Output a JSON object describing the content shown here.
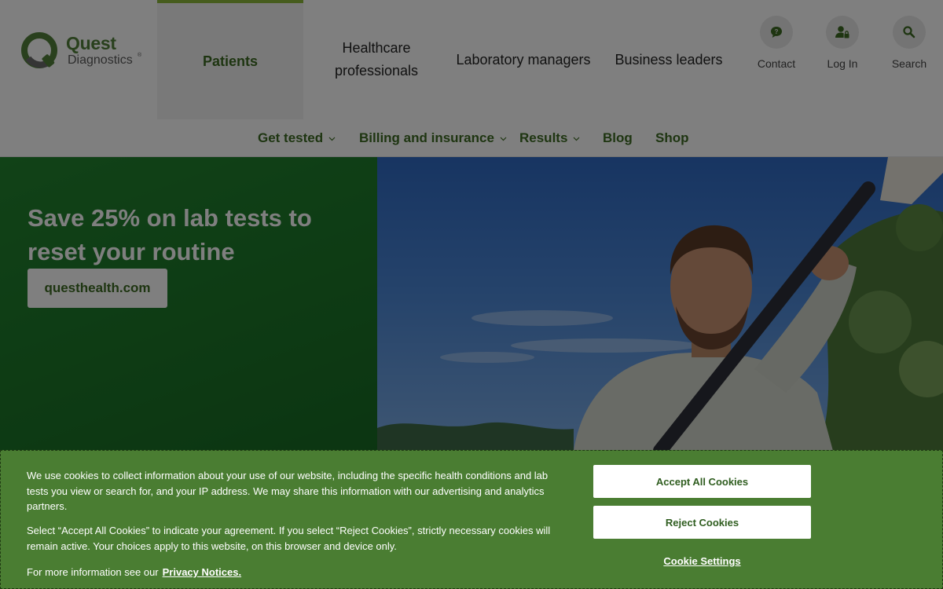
{
  "brand": {
    "name_line1": "Quest",
    "name_line2": "Diagnostics",
    "reg_mark": "®",
    "primary_color": "#52803a",
    "accent_color": "#8cb83a"
  },
  "audience_tabs": [
    {
      "label": "Patients",
      "active": true
    },
    {
      "label": "Healthcare professionals",
      "active": false
    },
    {
      "label": "Laboratory managers",
      "active": false
    },
    {
      "label": "Business leaders",
      "active": false
    }
  ],
  "utility_nav": [
    {
      "label": "Contact",
      "icon": "chat-bubble-icon"
    },
    {
      "label": "Log In",
      "icon": "user-lock-icon"
    },
    {
      "label": "Search",
      "icon": "search-icon"
    }
  ],
  "sub_nav": [
    {
      "label": "Get tested",
      "has_dropdown": true
    },
    {
      "label": "Billing and insurance",
      "has_dropdown": true
    },
    {
      "label": "Results",
      "has_dropdown": true
    },
    {
      "label": "Blog",
      "has_dropdown": false
    },
    {
      "label": "Shop",
      "has_dropdown": false
    }
  ],
  "hero": {
    "title": "Save 25% on lab tests to reset your routine",
    "cta_label": "questhealth.com",
    "bg_color": "#1d7a2a"
  },
  "cookie_banner": {
    "paragraph1": "We use cookies to collect information about your use of our website, including the specific health conditions and lab tests you view or search for, and your IP address. We may share this information with our advertising and analytics partners.",
    "paragraph2": "Select “Accept All Cookies” to indicate your agreement. If you select “Reject Cookies”, strictly necessary cookies will remain active. Your choices apply to this website, on this browser and device only.",
    "more_info_text": "For more information see our",
    "privacy_link": "Privacy Notices.",
    "accept_label": "Accept All Cookies",
    "reject_label": "Reject Cookies",
    "settings_label": "Cookie Settings",
    "bg_color": "#4a7d32"
  }
}
